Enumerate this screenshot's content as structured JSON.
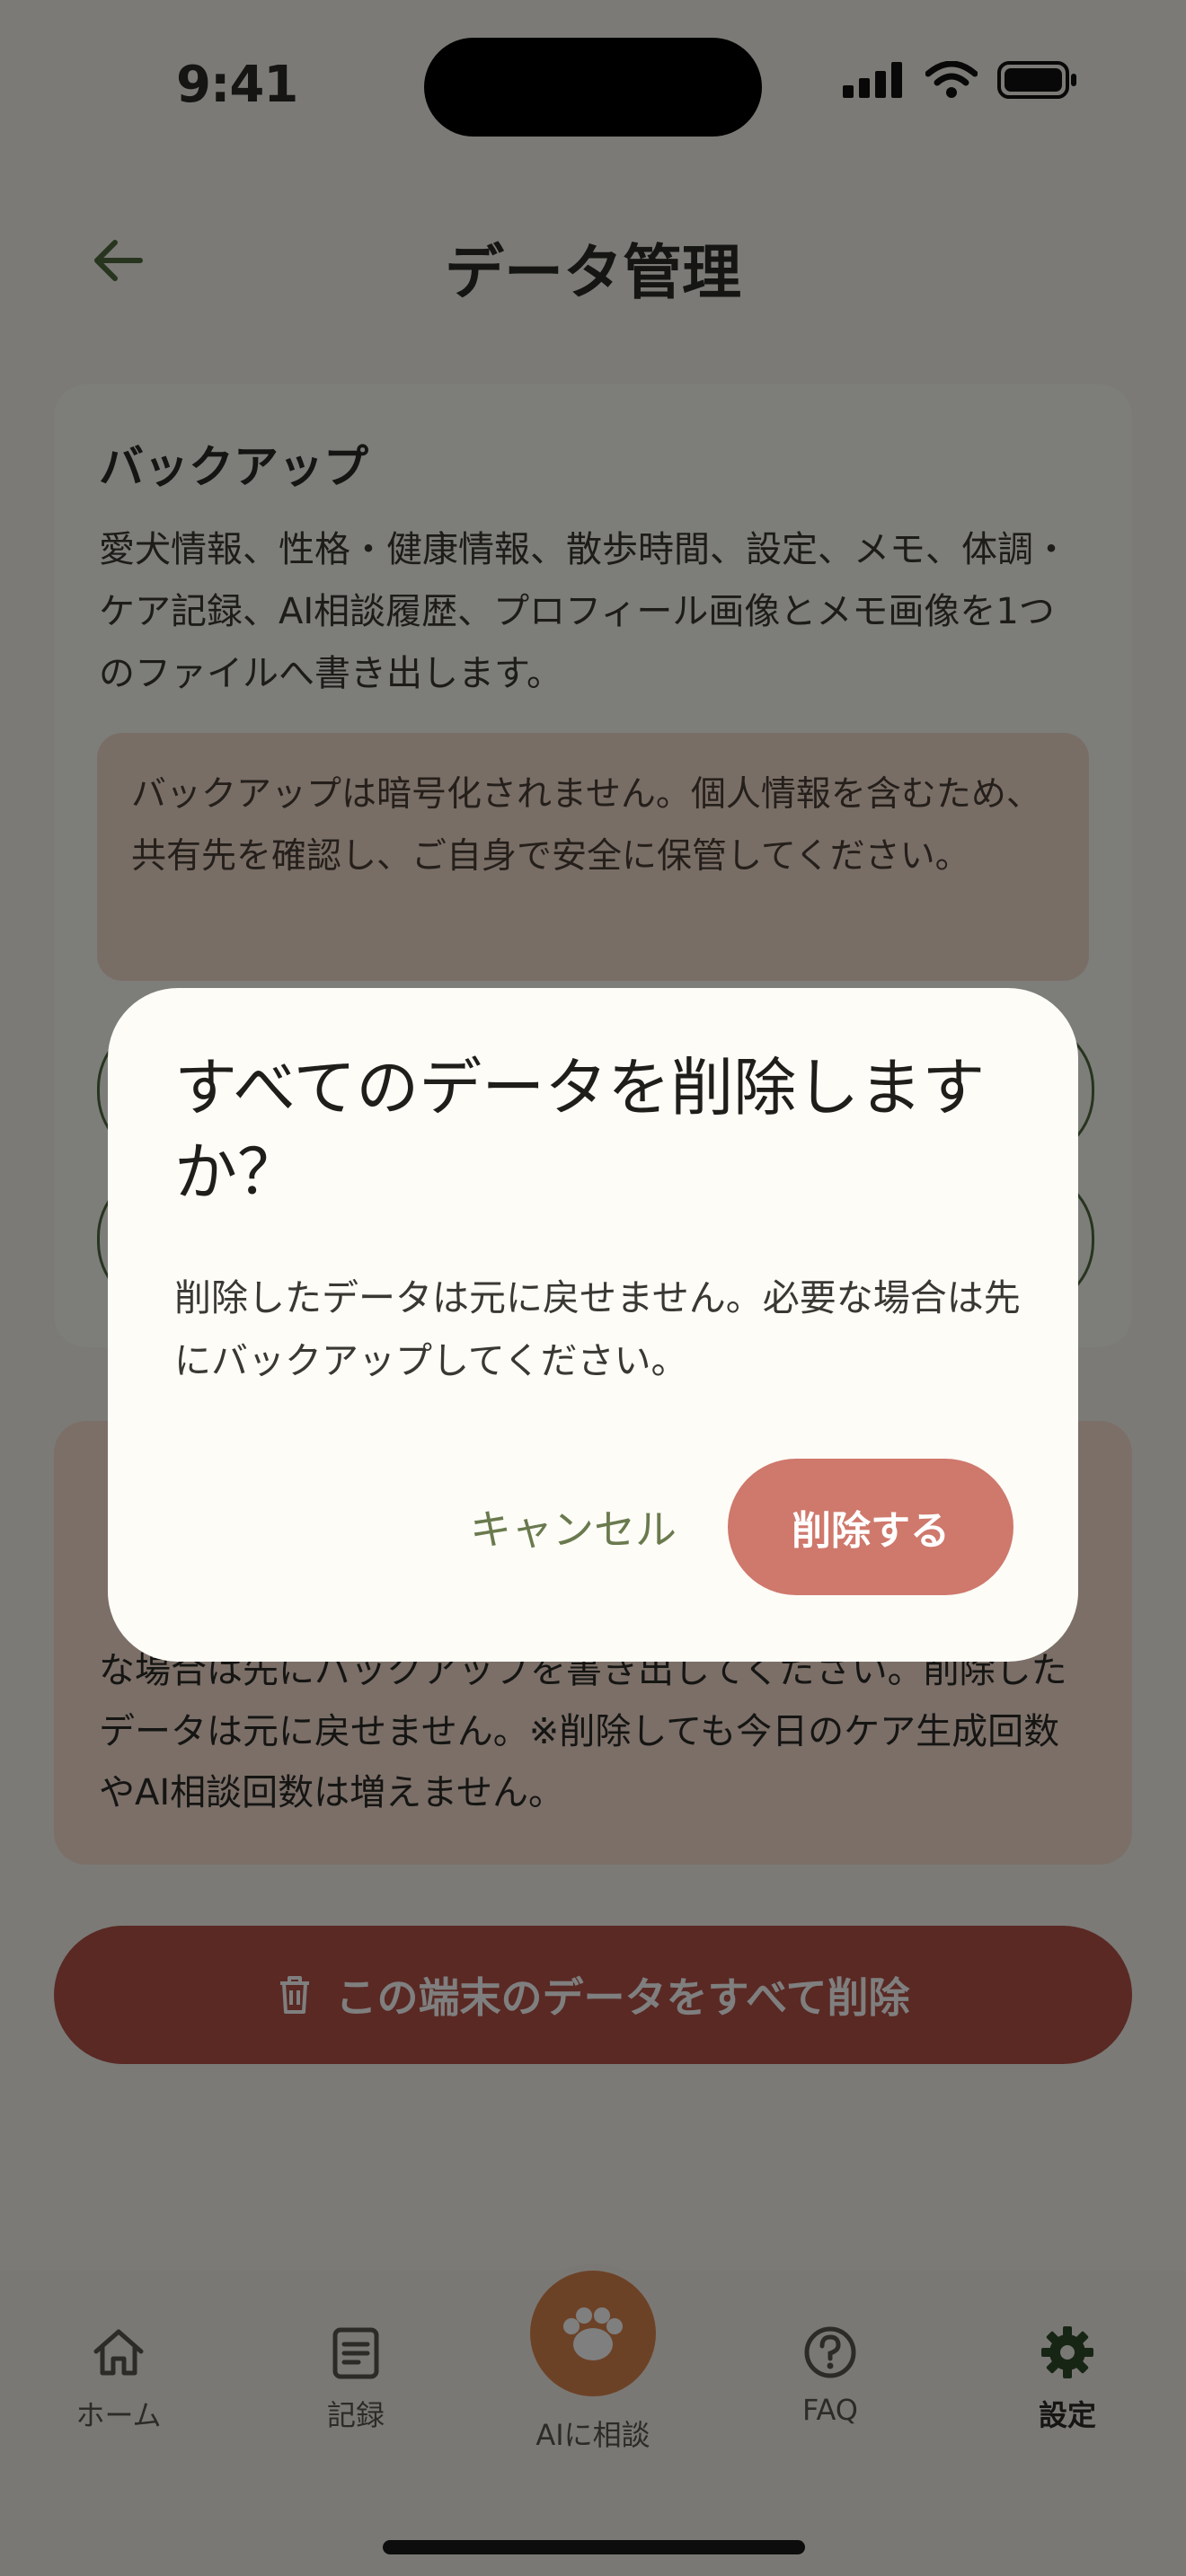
{
  "status_bar": {
    "time": "9:41"
  },
  "header": {
    "title": "データ管理"
  },
  "backup": {
    "heading": "バックアップ",
    "description": "愛犬情報、性格・健康情報、散歩時間、設定、メモ、体調・ケア記録、AI相談履歴、プロフィール画像とメモ画像を1つのファイルへ書き出します。",
    "warning": "バックアップは暗号化されません。個人情報を含むため、共有先を確認し、ご自身で安全に保管してください。"
  },
  "danger": {
    "text": "な場合は先にバックアップを書き出してください。削除したデータは元に戻せません。※削除しても今日のケア生成回数やAI相談回数は増えません。"
  },
  "delete_all_label": "この端末のデータをすべて削除",
  "tabs": [
    {
      "label": "ホーム",
      "icon": "home-icon"
    },
    {
      "label": "記録",
      "icon": "record-icon"
    },
    {
      "label": "AIに相談",
      "icon": "paw-icon"
    },
    {
      "label": "FAQ",
      "icon": "help-icon"
    },
    {
      "label": "設定",
      "icon": "gear-icon"
    }
  ],
  "dialog": {
    "title": "すべてのデータを削除しますか？",
    "message": "削除したデータは元に戻せません。必要な場合は先にバックアップしてください。",
    "cancel_label": "キャンセル",
    "confirm_label": "削除する"
  },
  "colors": {
    "accent_green": "#4e6a3f",
    "danger": "#b55249",
    "confirm": "#cf786c",
    "fab": "#d9844f"
  }
}
